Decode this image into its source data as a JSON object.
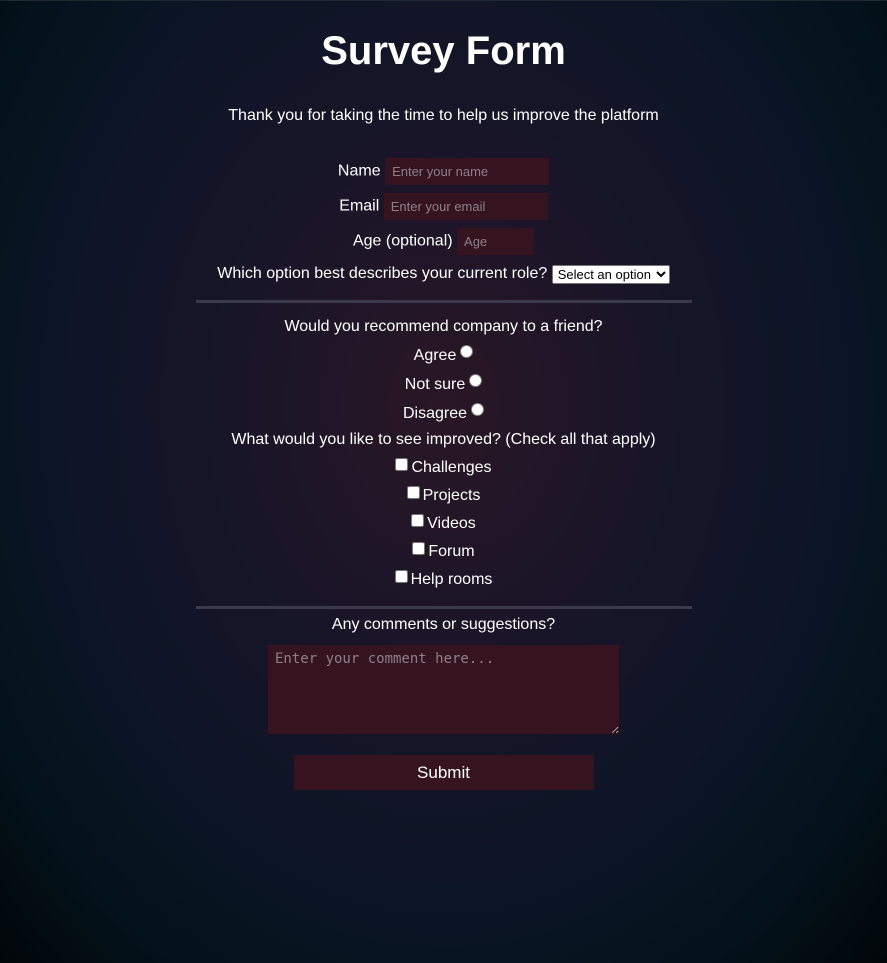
{
  "header": {
    "title": "Survey Form",
    "description": "Thank you for taking the time to help us improve the platform"
  },
  "fields": {
    "name": {
      "label": "Name",
      "placeholder": "Enter your name",
      "value": ""
    },
    "email": {
      "label": "Email",
      "placeholder": "Enter your email",
      "value": ""
    },
    "age": {
      "label": "Age (optional)",
      "placeholder": "Age",
      "value": ""
    },
    "role": {
      "label": "Which option best describes your current role?",
      "selected": "Select an option"
    }
  },
  "recommend": {
    "question": "Would you recommend company to a friend?",
    "options": [
      "Agree",
      "Not sure",
      "Disagree"
    ]
  },
  "improve": {
    "question": "What would you like to see improved? (Check all that apply)",
    "options": [
      "Challenges",
      "Projects",
      "Videos",
      "Forum",
      "Help rooms"
    ]
  },
  "comments": {
    "question": "Any comments or suggestions?",
    "placeholder": "Enter your comment here..."
  },
  "submit": {
    "label": "Submit"
  },
  "colors": {
    "field_bg": "#35141f",
    "divider": "#3a3a4c",
    "text": "#ffffff"
  }
}
